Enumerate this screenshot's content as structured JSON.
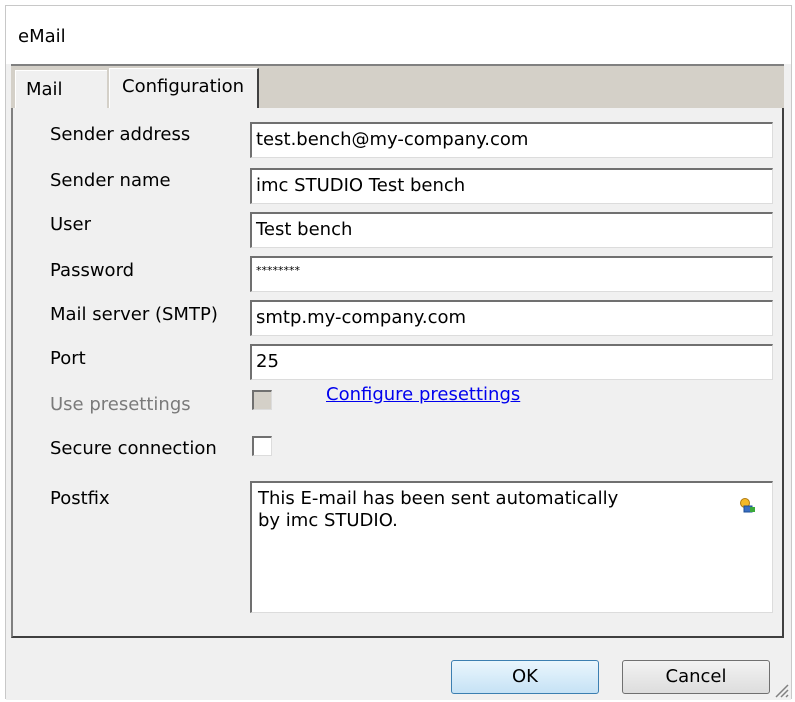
{
  "window": {
    "title": "eMail"
  },
  "tabs": [
    {
      "label": "Mail"
    },
    {
      "label": "Configuration"
    }
  ],
  "form": {
    "sender_address": {
      "label": "Sender address",
      "value": "test.bench@my-company.com"
    },
    "sender_name": {
      "label": "Sender name",
      "value": "imc STUDIO Test bench"
    },
    "user": {
      "label": "User",
      "value": "Test bench"
    },
    "password": {
      "label": "Password",
      "value": "********"
    },
    "mail_server": {
      "label": "Mail server (SMTP)",
      "value": "smtp.my-company.com"
    },
    "port": {
      "label": "Port",
      "value": "25"
    },
    "use_presettings": {
      "label": "Use presettings",
      "checked": false,
      "enabled": false
    },
    "configure_presettings_link": "Configure presettings",
    "secure_connection": {
      "label": "Secure connection",
      "checked": false
    },
    "postfix": {
      "label": "Postfix",
      "lines": [
        "This E-mail has been sent automatically",
        "by imc STUDIO."
      ],
      "icon": "insert-field-icon"
    }
  },
  "buttons": {
    "ok": "OK",
    "cancel": "Cancel"
  },
  "colors": {
    "link": "#0000ee",
    "ok_border": "#3c7fb1"
  }
}
